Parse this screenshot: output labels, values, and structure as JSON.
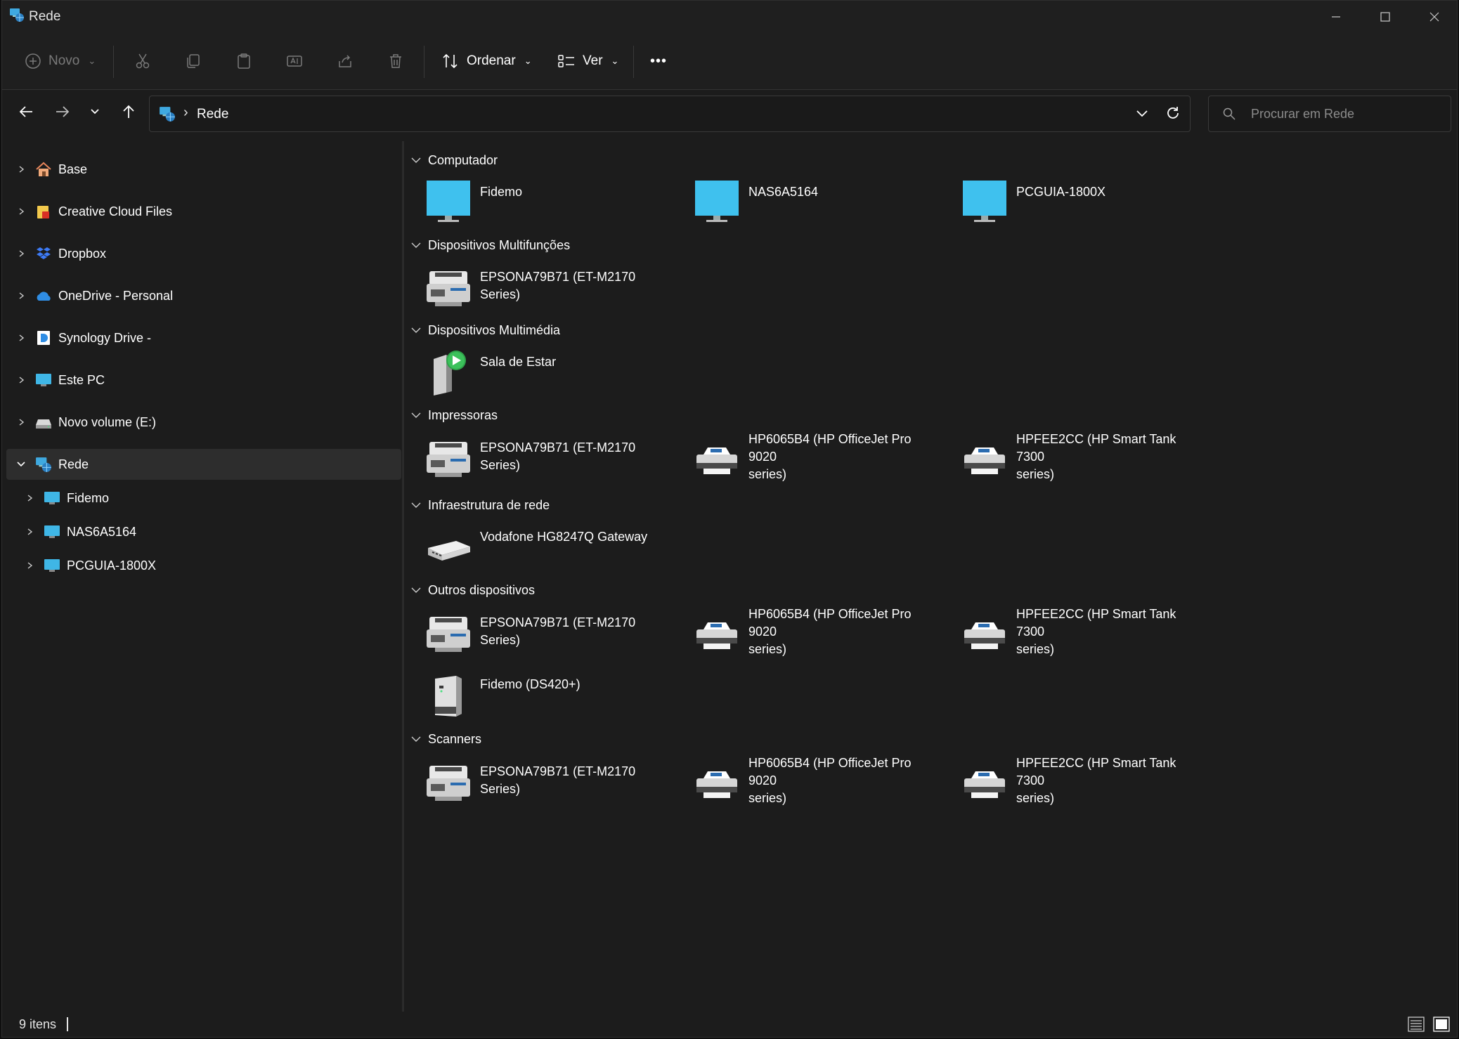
{
  "window": {
    "title": "Rede"
  },
  "toolbar": {
    "new_label": "Novo",
    "sort_label": "Ordenar",
    "view_label": "Ver",
    "more_label": "•••"
  },
  "address": {
    "breadcrumb": "Rede",
    "separator": "›"
  },
  "search": {
    "placeholder": "Procurar em Rede"
  },
  "sidebar": {
    "items": [
      {
        "label": "Base",
        "icon": "home-icon"
      },
      {
        "label": "Creative Cloud Files",
        "icon": "creative-cloud-folder-icon"
      },
      {
        "label": "Dropbox",
        "icon": "dropbox-icon"
      },
      {
        "label": "OneDrive - Personal",
        "icon": "onedrive-cloud-icon"
      },
      {
        "label": "Synology Drive -",
        "icon": "synology-drive-icon"
      },
      {
        "label": "Este PC",
        "icon": "this-pc-icon"
      },
      {
        "label": "Novo volume (E:)",
        "icon": "drive-icon"
      },
      {
        "label": "Rede",
        "icon": "network-icon"
      },
      {
        "label": "Fidemo",
        "icon": "computer-icon"
      },
      {
        "label": "NAS6A5164",
        "icon": "computer-icon"
      },
      {
        "label": "PCGUIA-1800X",
        "icon": "computer-icon"
      }
    ]
  },
  "groups": [
    {
      "name": "Computador",
      "items": [
        {
          "line1": "Fidemo",
          "line2": "",
          "icon": "monitor-icon"
        },
        {
          "line1": "NAS6A5164",
          "line2": "",
          "icon": "monitor-icon"
        },
        {
          "line1": "PCGUIA-1800X",
          "line2": "",
          "icon": "monitor-icon"
        }
      ]
    },
    {
      "name": "Dispositivos Multifunções",
      "items": [
        {
          "line1": "EPSONA79B71 (ET-M2170 Series)",
          "line2": "",
          "icon": "multifunction-printer-icon"
        }
      ]
    },
    {
      "name": "Dispositivos Multimédia",
      "items": [
        {
          "line1": "Sala de Estar",
          "line2": "",
          "icon": "media-device-icon"
        }
      ]
    },
    {
      "name": "Impressoras",
      "items": [
        {
          "line1": "EPSONA79B71 (ET-M2170 Series)",
          "line2": "",
          "icon": "multifunction-printer-icon"
        },
        {
          "line1": "HP6065B4 (HP OfficeJet Pro 9020",
          "line2": "series)",
          "icon": "printer-icon"
        },
        {
          "line1": "HPFEE2CC (HP Smart Tank 7300",
          "line2": "series)",
          "icon": "printer-icon"
        }
      ]
    },
    {
      "name": "Infraestrutura de rede",
      "items": [
        {
          "line1": "Vodafone HG8247Q Gateway",
          "line2": "",
          "icon": "router-icon"
        }
      ]
    },
    {
      "name": "Outros dispositivos",
      "items": [
        {
          "line1": "EPSONA79B71 (ET-M2170 Series)",
          "line2": "",
          "icon": "multifunction-printer-icon"
        },
        {
          "line1": "HP6065B4 (HP OfficeJet Pro 9020",
          "line2": "series)",
          "icon": "printer-icon"
        },
        {
          "line1": "HPFEE2CC (HP Smart Tank 7300",
          "line2": "series)",
          "icon": "printer-icon"
        },
        {
          "line1": "Fidemo (DS420+)",
          "line2": "",
          "icon": "nas-server-icon"
        }
      ]
    },
    {
      "name": "Scanners",
      "items": [
        {
          "line1": "EPSONA79B71 (ET-M2170 Series)",
          "line2": "",
          "icon": "multifunction-printer-icon"
        },
        {
          "line1": "HP6065B4 (HP OfficeJet Pro 9020",
          "line2": "series)",
          "icon": "printer-icon"
        },
        {
          "line1": "HPFEE2CC (HP Smart Tank 7300",
          "line2": "series)",
          "icon": "printer-icon"
        }
      ]
    }
  ],
  "status": {
    "item_count": "9 itens"
  },
  "colors": {
    "background": "#1c1c1c",
    "selected": "#2d2d2d",
    "accent": "#3fb6e6"
  }
}
